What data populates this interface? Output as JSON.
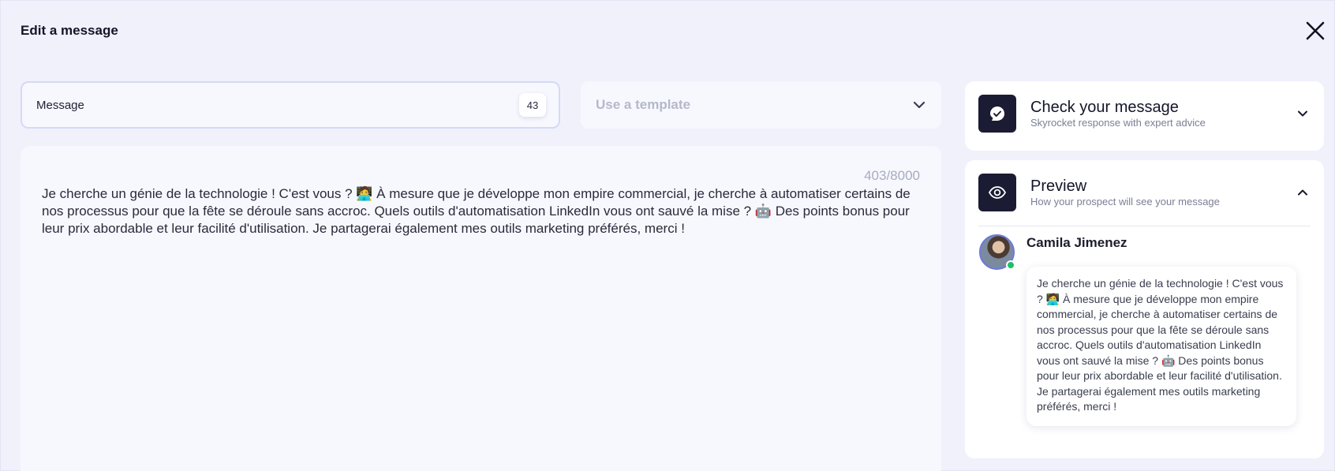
{
  "modal": {
    "title": "Edit a message",
    "close_icon": "close-icon"
  },
  "name_field": {
    "value": "Message",
    "count": "43"
  },
  "template": {
    "placeholder": "Use a template",
    "icon": "chevron-down-icon"
  },
  "editor": {
    "char_count": "403/8000",
    "text": "Je cherche un génie de la technologie ! C'est vous ? 🧑‍💻 À mesure que je développe mon empire commercial, je cherche à automatiser certains de nos processus pour que la fête se déroule sans accroc. Quels outils d'automatisation LinkedIn vous ont sauvé la mise ? 🤖 Des points bonus pour leur prix abordable et leur facilité d'utilisation. Je partagerai également mes outils marketing préférés, merci !"
  },
  "check_card": {
    "title": "Check your message",
    "subtitle": "Skyrocket response with expert advice",
    "icon": "rocket-check-icon"
  },
  "preview_card": {
    "title": "Preview",
    "subtitle": "How your prospect will see your message",
    "icon": "eye-icon",
    "contact_name": "Camila Jimenez",
    "message": "Je cherche un génie de la technologie ! C'est vous ? 🧑‍💻 À mesure que je développe mon empire commercial, je cherche à automatiser certains de nos processus pour que la fête se déroule sans accroc. Quels outils d'automatisation LinkedIn vous ont sauvé la mise ? 🤖 Des points bonus pour leur prix abordable et leur facilité d'utilisation. Je partagerai également mes outils marketing préférés, merci !"
  },
  "colors": {
    "background": "#f0f1fb",
    "panel": "#f7f8fe",
    "icon_tile": "#1b1b33",
    "online": "#1fbf6a"
  }
}
